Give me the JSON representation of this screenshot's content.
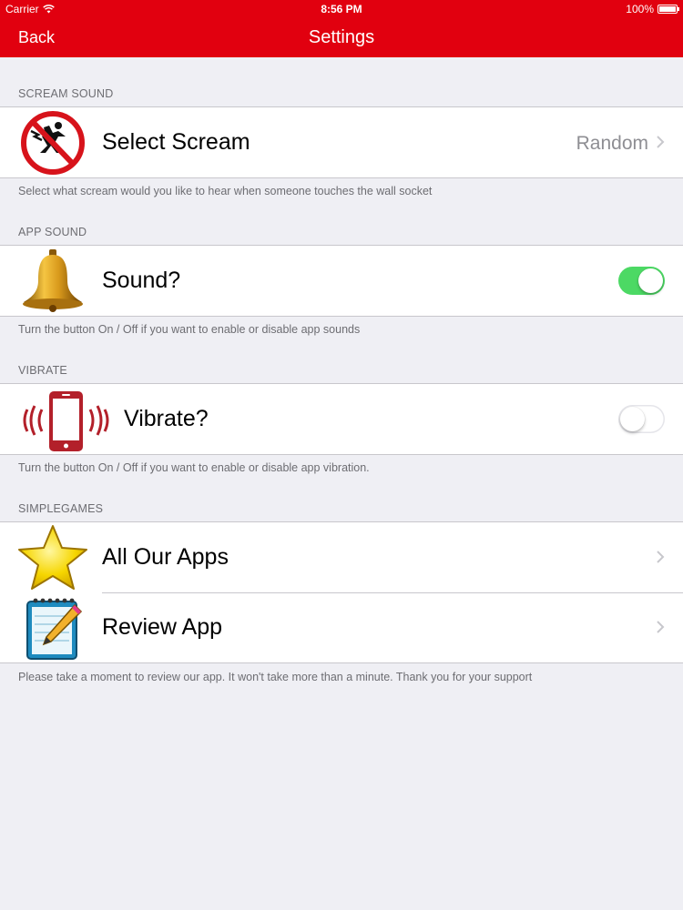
{
  "status_bar": {
    "carrier": "Carrier",
    "time": "8:56 PM",
    "battery": "100%",
    "battery_level": 1.0
  },
  "nav": {
    "back_label": "Back",
    "title": "Settings"
  },
  "sections": {
    "scream": {
      "header": "SCREAM SOUND",
      "row_label": "Select Scream",
      "row_value": "Random",
      "icon": "no-electric-shock-icon",
      "footer": "Select what scream would you like to hear when someone touches the wall socket"
    },
    "app_sound": {
      "header": "APP SOUND",
      "row_label": "Sound?",
      "toggle_on": true,
      "icon": "bell-icon",
      "footer": "Turn the button On / Off if you want to enable or disable app sounds"
    },
    "vibrate": {
      "header": "VIBRATE",
      "row_label": "Vibrate?",
      "toggle_on": false,
      "icon": "vibrating-phone-icon",
      "footer": "Turn the button On / Off if you want to enable or disable app vibration."
    },
    "simplegames": {
      "header": "SIMPLEGAMES",
      "rows": [
        {
          "label": "All Our Apps",
          "icon": "star-icon"
        },
        {
          "label": "Review App",
          "icon": "notepad-pencil-icon"
        }
      ],
      "footer": "Please take a moment to review our app. It won't take more than a minute. Thank you for your support"
    }
  },
  "colors": {
    "nav_red": "#e1000f",
    "toggle_green": "#4cd964",
    "background": "#efeff4",
    "secondary_text": "#6d6d72",
    "value_text": "#8e8e93"
  }
}
